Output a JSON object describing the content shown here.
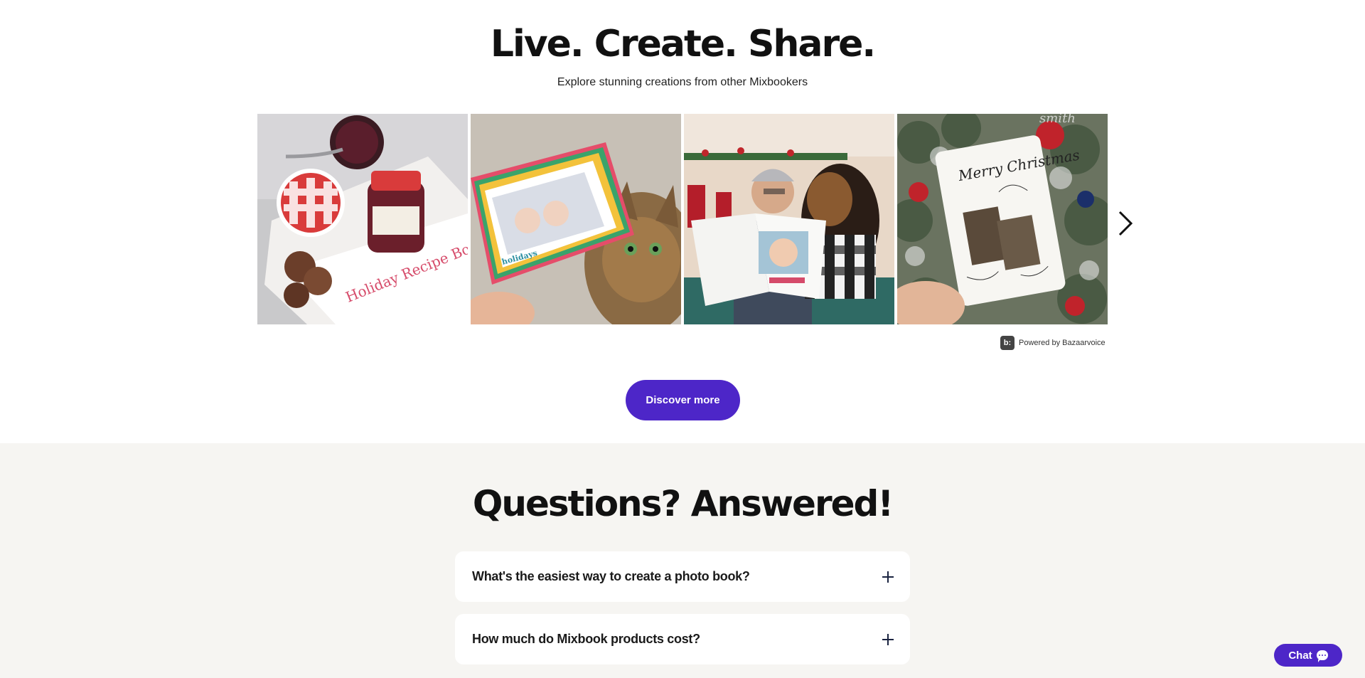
{
  "gallery": {
    "title": "Live. Create. Share.",
    "subtitle": "Explore stunning creations from other Mixbookers",
    "tiles": [
      {
        "name": "holiday-recipe-book-photo",
        "caption": "Holiday Recipe Book"
      },
      {
        "name": "holidays-card-with-cat-photo",
        "caption": "holidays"
      },
      {
        "name": "man-reading-photo-book-with-dog-photo",
        "caption": ""
      },
      {
        "name": "merry-christmas-card-on-tree-photo",
        "caption": "Merry Christmas"
      }
    ],
    "next_icon": "chevron-right-icon",
    "powered_by": "Powered by Bazaarvoice",
    "bv_logo_text": "b:",
    "discover_label": "Discover more"
  },
  "faq": {
    "title": "Questions? Answered!",
    "items": [
      {
        "question": "What's the easiest way to create a photo book?"
      },
      {
        "question": "How much do Mixbook products cost?"
      }
    ]
  },
  "chat": {
    "label": "Chat",
    "icon": "chat-bubble-icon"
  },
  "colors": {
    "accent": "#4d26c8",
    "faq_background": "#f6f5f2",
    "text": "#111111"
  }
}
